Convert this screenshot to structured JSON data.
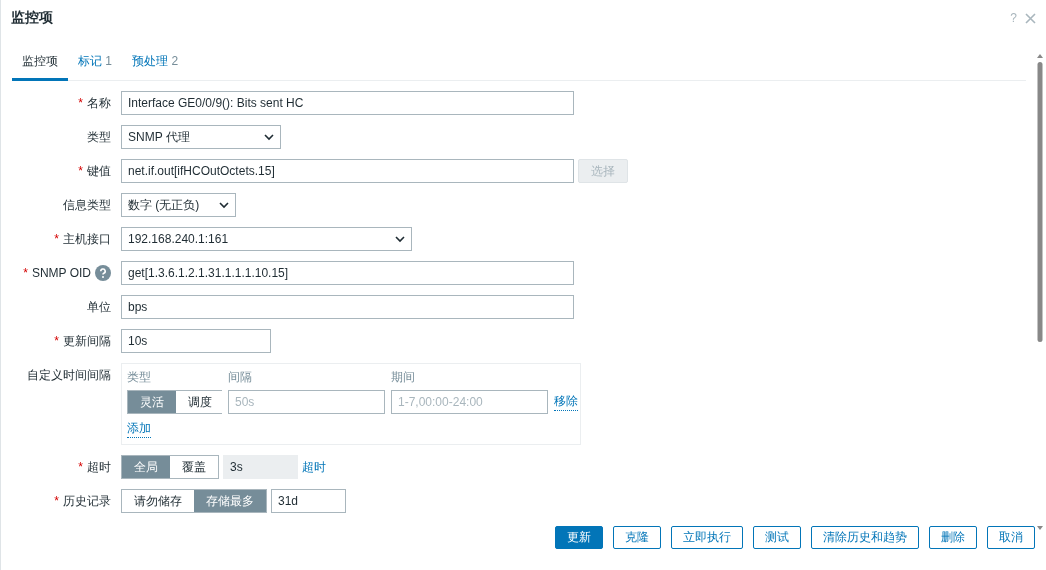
{
  "dialog": {
    "title": "监控项",
    "help": "?"
  },
  "tabs": [
    {
      "label": "监控项",
      "selected": true
    },
    {
      "label": "标记",
      "count": "1",
      "selected": false
    },
    {
      "label": "预处理",
      "count": "2",
      "selected": false
    }
  ],
  "fields": [
    {
      "kind": "input",
      "label": "名称",
      "required_mark": "*",
      "value": "Interface GE0/0/9(): Bits sent HC"
    },
    {
      "kind": "select",
      "label": "类型",
      "value": "SNMP 代理"
    },
    {
      "kind": "input_button",
      "label": "键值",
      "required_mark": "*",
      "value": "net.if.out[ifHCOutOctets.15]",
      "button": {
        "label": "选择",
        "disabled": true
      }
    },
    {
      "kind": "select",
      "label": "信息类型",
      "value": "数字 (无正负)"
    },
    {
      "kind": "select",
      "label": "主机接口",
      "required_mark": "*",
      "value": "192.168.240.1:161"
    },
    {
      "kind": "input",
      "label": "SNMP OID",
      "required_mark": "*",
      "help": true,
      "value": "get[1.3.6.1.2.1.31.1.1.1.10.15]"
    },
    {
      "kind": "input",
      "label": "单位",
      "value": "bps"
    },
    {
      "kind": "input",
      "label": "更新间隔",
      "required_mark": "*",
      "value": "10s"
    },
    {
      "kind": "intervals",
      "label": "自定义时间间隔",
      "headers": [
        "类型",
        "间隔",
        "期间"
      ],
      "rows": [
        {
          "options": [
            {
              "label": "灵活",
              "selected": true
            },
            {
              "label": "调度",
              "selected": false
            }
          ],
          "interval_placeholder": "50s",
          "period_placeholder": "1-7,00:00-24:00",
          "remove": "移除"
        }
      ],
      "add": "添加"
    },
    {
      "kind": "toggle_input",
      "label": "超时",
      "required_mark": "*",
      "options": [
        {
          "label": "全局",
          "selected": true
        },
        {
          "label": "覆盖",
          "selected": false
        }
      ],
      "value": "3s",
      "disabled": true,
      "link": "超时"
    },
    {
      "kind": "toggle_input",
      "label": "历史记录",
      "required_mark": "*",
      "options": [
        {
          "label": "请勿储存",
          "selected": false
        },
        {
          "label": "存储最多",
          "selected": true
        }
      ],
      "value": "31d",
      "disabled": false
    }
  ],
  "buttons": [
    {
      "label": "更新",
      "primary": true
    },
    {
      "label": "克隆",
      "primary": false
    },
    {
      "label": "立即执行",
      "primary": false
    },
    {
      "label": "测试",
      "primary": false
    },
    {
      "label": "清除历史和趋势",
      "primary": false
    },
    {
      "label": "删除",
      "primary": false
    },
    {
      "label": "取消",
      "primary": false
    }
  ]
}
